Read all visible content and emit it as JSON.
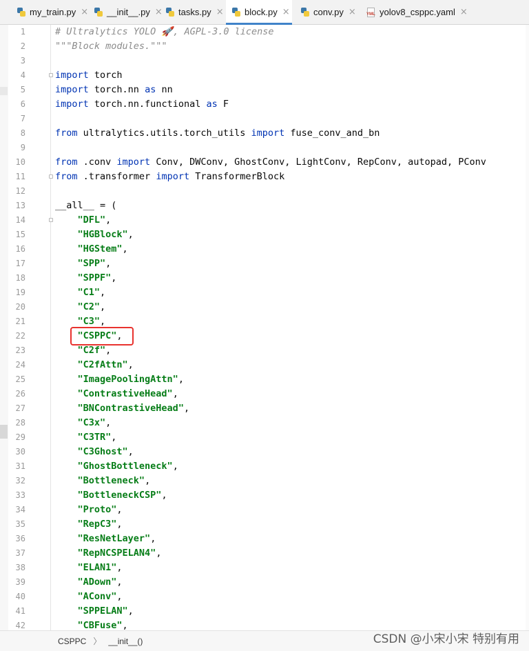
{
  "tabs": [
    {
      "label": "my_train.py",
      "icon": "python-file-icon",
      "active": false
    },
    {
      "label": "__init__.py",
      "icon": "python-file-icon",
      "active": false
    },
    {
      "label": "tasks.py",
      "icon": "python-file-icon",
      "active": false
    },
    {
      "label": "block.py",
      "icon": "python-file-icon",
      "active": true
    },
    {
      "label": "conv.py",
      "icon": "python-file-icon",
      "active": false
    },
    {
      "label": "yolov8_csppc.yaml",
      "icon": "yaml-file-icon",
      "active": false
    }
  ],
  "tab_close_glyph": "×",
  "yml_label": "YML",
  "code_lines": [
    [
      {
        "t": "# Ultralytics YOLO 🚀, AGPL-3.0 license",
        "c": "cmt"
      }
    ],
    [
      {
        "t": "\"\"\"Block modules.\"\"\"",
        "c": "cmt"
      }
    ],
    [],
    [
      {
        "t": "import",
        "c": "kw"
      },
      {
        "t": " torch",
        "c": "plain"
      }
    ],
    [
      {
        "t": "import",
        "c": "kw"
      },
      {
        "t": " torch.nn ",
        "c": "plain"
      },
      {
        "t": "as",
        "c": "kw"
      },
      {
        "t": " nn",
        "c": "plain"
      }
    ],
    [
      {
        "t": "import",
        "c": "kw"
      },
      {
        "t": " torch.nn.functional ",
        "c": "plain"
      },
      {
        "t": "as",
        "c": "kw"
      },
      {
        "t": " F",
        "c": "plain"
      }
    ],
    [],
    [
      {
        "t": "from",
        "c": "kw"
      },
      {
        "t": " ultralytics.utils.torch_utils ",
        "c": "plain"
      },
      {
        "t": "import",
        "c": "kw"
      },
      {
        "t": " fuse_conv_and_bn",
        "c": "plain"
      }
    ],
    [],
    [
      {
        "t": "from",
        "c": "kw"
      },
      {
        "t": " .conv ",
        "c": "plain"
      },
      {
        "t": "import",
        "c": "kw"
      },
      {
        "t": " Conv, DWConv, GhostConv, LightConv, RepConv, autopad, PConv",
        "c": "plain"
      }
    ],
    [
      {
        "t": "from",
        "c": "kw"
      },
      {
        "t": " .transformer ",
        "c": "plain"
      },
      {
        "t": "import",
        "c": "kw"
      },
      {
        "t": " TransformerBlock",
        "c": "plain"
      }
    ],
    [],
    [
      {
        "t": "__all__ = (",
        "c": "plain"
      }
    ],
    [
      {
        "t": "    ",
        "c": "plain"
      },
      {
        "t": "\"DFL\"",
        "c": "str"
      },
      {
        "t": ",",
        "c": "plain"
      }
    ],
    [
      {
        "t": "    ",
        "c": "plain"
      },
      {
        "t": "\"HGBlock\"",
        "c": "str"
      },
      {
        "t": ",",
        "c": "plain"
      }
    ],
    [
      {
        "t": "    ",
        "c": "plain"
      },
      {
        "t": "\"HGStem\"",
        "c": "str"
      },
      {
        "t": ",",
        "c": "plain"
      }
    ],
    [
      {
        "t": "    ",
        "c": "plain"
      },
      {
        "t": "\"SPP\"",
        "c": "str"
      },
      {
        "t": ",",
        "c": "plain"
      }
    ],
    [
      {
        "t": "    ",
        "c": "plain"
      },
      {
        "t": "\"SPPF\"",
        "c": "str"
      },
      {
        "t": ",",
        "c": "plain"
      }
    ],
    [
      {
        "t": "    ",
        "c": "plain"
      },
      {
        "t": "\"C1\"",
        "c": "str"
      },
      {
        "t": ",",
        "c": "plain"
      }
    ],
    [
      {
        "t": "    ",
        "c": "plain"
      },
      {
        "t": "\"C2\"",
        "c": "str"
      },
      {
        "t": ",",
        "c": "plain"
      }
    ],
    [
      {
        "t": "    ",
        "c": "plain"
      },
      {
        "t": "\"C3\"",
        "c": "str"
      },
      {
        "t": ",",
        "c": "plain"
      }
    ],
    [
      {
        "t": "    ",
        "c": "plain"
      },
      {
        "t": "\"CSPPC\"",
        "c": "str"
      },
      {
        "t": ",",
        "c": "plain"
      }
    ],
    [
      {
        "t": "    ",
        "c": "plain"
      },
      {
        "t": "\"C2f\"",
        "c": "str"
      },
      {
        "t": ",",
        "c": "plain"
      }
    ],
    [
      {
        "t": "    ",
        "c": "plain"
      },
      {
        "t": "\"C2fAttn\"",
        "c": "str"
      },
      {
        "t": ",",
        "c": "plain"
      }
    ],
    [
      {
        "t": "    ",
        "c": "plain"
      },
      {
        "t": "\"ImagePoolingAttn\"",
        "c": "str"
      },
      {
        "t": ",",
        "c": "plain"
      }
    ],
    [
      {
        "t": "    ",
        "c": "plain"
      },
      {
        "t": "\"ContrastiveHead\"",
        "c": "str"
      },
      {
        "t": ",",
        "c": "plain"
      }
    ],
    [
      {
        "t": "    ",
        "c": "plain"
      },
      {
        "t": "\"BNContrastiveHead\"",
        "c": "str"
      },
      {
        "t": ",",
        "c": "plain"
      }
    ],
    [
      {
        "t": "    ",
        "c": "plain"
      },
      {
        "t": "\"C3x\"",
        "c": "str"
      },
      {
        "t": ",",
        "c": "plain"
      }
    ],
    [
      {
        "t": "    ",
        "c": "plain"
      },
      {
        "t": "\"C3TR\"",
        "c": "str"
      },
      {
        "t": ",",
        "c": "plain"
      }
    ],
    [
      {
        "t": "    ",
        "c": "plain"
      },
      {
        "t": "\"C3Ghost\"",
        "c": "str"
      },
      {
        "t": ",",
        "c": "plain"
      }
    ],
    [
      {
        "t": "    ",
        "c": "plain"
      },
      {
        "t": "\"GhostBottleneck\"",
        "c": "str"
      },
      {
        "t": ",",
        "c": "plain"
      }
    ],
    [
      {
        "t": "    ",
        "c": "plain"
      },
      {
        "t": "\"Bottleneck\"",
        "c": "str"
      },
      {
        "t": ",",
        "c": "plain"
      }
    ],
    [
      {
        "t": "    ",
        "c": "plain"
      },
      {
        "t": "\"BottleneckCSP\"",
        "c": "str"
      },
      {
        "t": ",",
        "c": "plain"
      }
    ],
    [
      {
        "t": "    ",
        "c": "plain"
      },
      {
        "t": "\"Proto\"",
        "c": "str"
      },
      {
        "t": ",",
        "c": "plain"
      }
    ],
    [
      {
        "t": "    ",
        "c": "plain"
      },
      {
        "t": "\"RepC3\"",
        "c": "str"
      },
      {
        "t": ",",
        "c": "plain"
      }
    ],
    [
      {
        "t": "    ",
        "c": "plain"
      },
      {
        "t": "\"ResNetLayer\"",
        "c": "str"
      },
      {
        "t": ",",
        "c": "plain"
      }
    ],
    [
      {
        "t": "    ",
        "c": "plain"
      },
      {
        "t": "\"RepNCSPELAN4\"",
        "c": "str"
      },
      {
        "t": ",",
        "c": "plain"
      }
    ],
    [
      {
        "t": "    ",
        "c": "plain"
      },
      {
        "t": "\"ELAN1\"",
        "c": "str"
      },
      {
        "t": ",",
        "c": "plain"
      }
    ],
    [
      {
        "t": "    ",
        "c": "plain"
      },
      {
        "t": "\"ADown\"",
        "c": "str"
      },
      {
        "t": ",",
        "c": "plain"
      }
    ],
    [
      {
        "t": "    ",
        "c": "plain"
      },
      {
        "t": "\"AConv\"",
        "c": "str"
      },
      {
        "t": ",",
        "c": "plain"
      }
    ],
    [
      {
        "t": "    ",
        "c": "plain"
      },
      {
        "t": "\"SPPELAN\"",
        "c": "str"
      },
      {
        "t": ",",
        "c": "plain"
      }
    ],
    [
      {
        "t": "    ",
        "c": "plain"
      },
      {
        "t": "\"CBFuse\"",
        "c": "str"
      },
      {
        "t": ",",
        "c": "plain"
      }
    ]
  ],
  "highlighted_line": 22,
  "breadcrumb": [
    "CSPPC",
    "__init__()"
  ],
  "breadcrumb_sep": "〉",
  "watermark": "CSDN @小宋小宋 特别有用",
  "colors": {
    "keyword": "#0033b3",
    "string": "#067d17",
    "comment": "#8c8c8c",
    "highlight_box": "#e8322e",
    "active_tab_underline": "#4083c9"
  }
}
